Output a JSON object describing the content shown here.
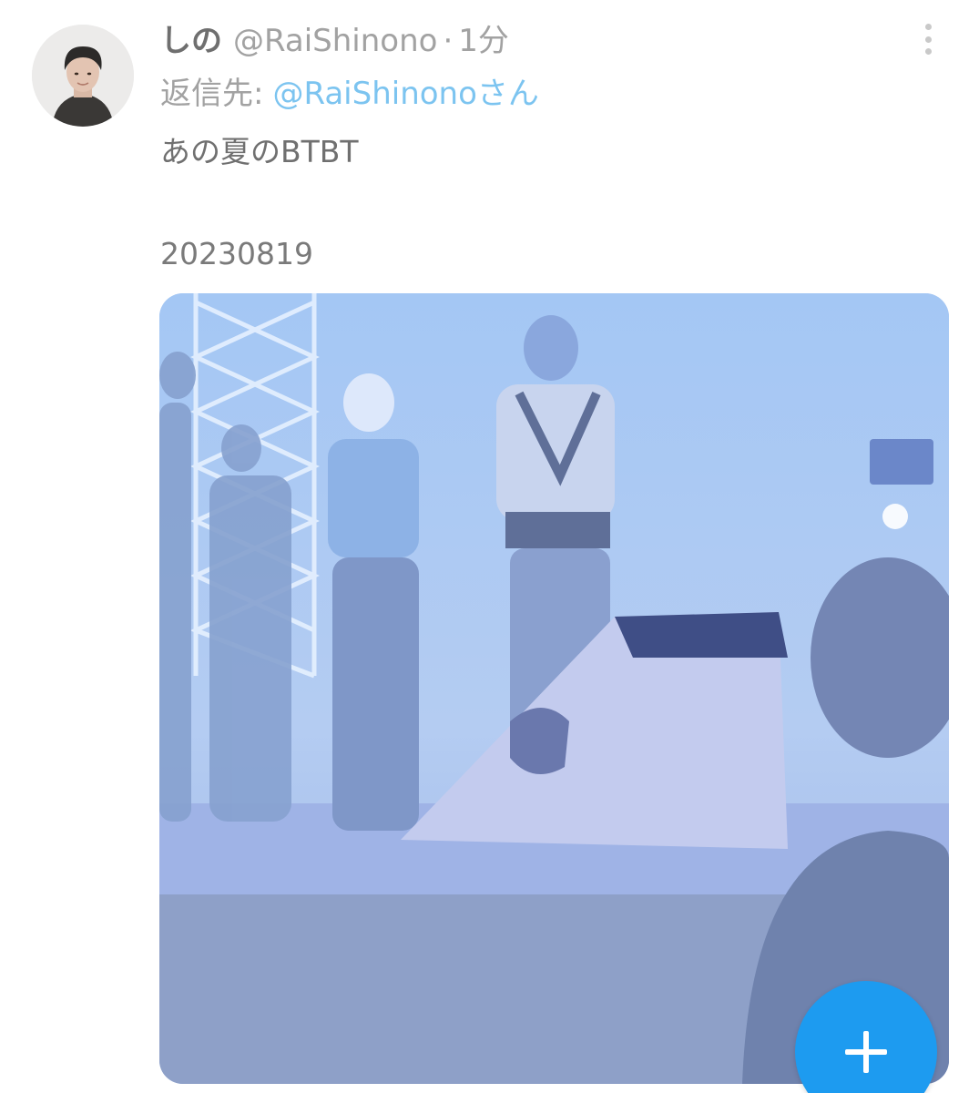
{
  "tweet": {
    "display_name": "しの",
    "handle": "@RaiShinono",
    "separator": "·",
    "time": "1分",
    "reply_label": "返信先:",
    "reply_to": "@RaiShinonoさん",
    "text": "あの夏のBTBT",
    "date": "20230819",
    "more_icon": "more-vertical-icon",
    "media": "concert-stage-photo"
  },
  "fab": {
    "icon": "plus-icon",
    "color": "#1d9bf0"
  },
  "colors": {
    "link": "#7cc4f0",
    "muted_text": "#a2a2a2",
    "body_text": "#707070"
  }
}
